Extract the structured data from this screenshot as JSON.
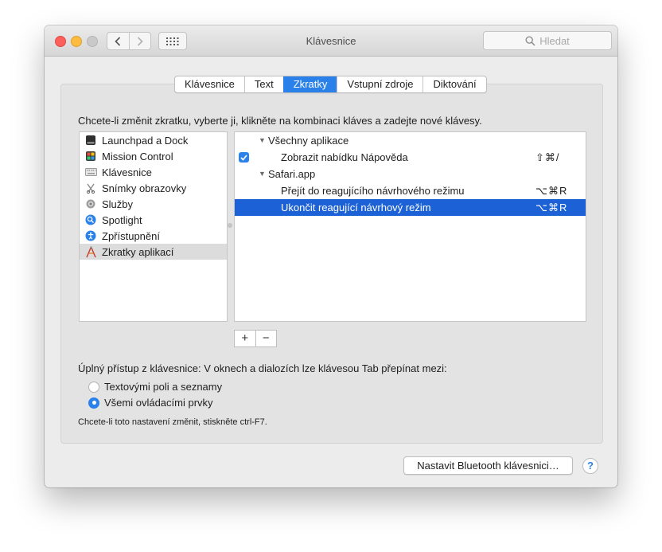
{
  "window": {
    "title": "Klávesnice"
  },
  "search": {
    "placeholder": "Hledat"
  },
  "icons": {
    "back": "chevron-left-icon",
    "forward": "chevron-right-icon",
    "grid": "grid-icon",
    "search": "search-icon"
  },
  "tabs": [
    {
      "label": "Klávesnice",
      "active": false
    },
    {
      "label": "Text",
      "active": false
    },
    {
      "label": "Zkratky",
      "active": true
    },
    {
      "label": "Vstupní zdroje",
      "active": false
    },
    {
      "label": "Diktování",
      "active": false
    }
  ],
  "instructions": "Chcete-li změnit zkratku, vyberte ji, klikněte na kombinaci kláves a zadejte nové klávesy.",
  "categories": [
    {
      "label": "Launchpad a Dock",
      "icon": "launchpad-icon"
    },
    {
      "label": "Mission Control",
      "icon": "mission-control-icon"
    },
    {
      "label": "Klávesnice",
      "icon": "keyboard-icon"
    },
    {
      "label": "Snímky obrazovky",
      "icon": "screenshot-icon"
    },
    {
      "label": "Služby",
      "icon": "gear-icon"
    },
    {
      "label": "Spotlight",
      "icon": "spotlight-icon"
    },
    {
      "label": "Zpřístupnění",
      "icon": "accessibility-icon"
    },
    {
      "label": "Zkratky aplikací",
      "icon": "app-shortcuts-icon",
      "selected": true
    }
  ],
  "shortcuts": [
    {
      "type": "group",
      "label": "Všechny aplikace"
    },
    {
      "type": "item",
      "label": "Zobrazit nabídku Nápověda",
      "keys": "⇧⌘/",
      "checked": true
    },
    {
      "type": "group",
      "label": "Safari.app"
    },
    {
      "type": "item",
      "label": "Přejít do reagujícího návrhového režimu",
      "keys": "⌥⌘R"
    },
    {
      "type": "item",
      "label": "Ukončit reagující návrhový režim",
      "keys": "⌥⌘R",
      "selected": true
    }
  ],
  "controls": {
    "add": "+",
    "remove": "−"
  },
  "keyboard_access": {
    "label": "Úplný přístup z klávesnice: V oknech a dialozích lze klávesou Tab přepínat mezi:",
    "options": [
      {
        "label": "Textovými poli a seznamy",
        "selected": false
      },
      {
        "label": "Všemi ovládacími prvky",
        "selected": true
      }
    ],
    "hint": "Chcete-li toto nastavení změnit, stiskněte ctrl-F7."
  },
  "bluetooth_button": "Nastavit Bluetooth klávesnici…",
  "help_button": "?",
  "colors": {
    "accent": "#2b81ea",
    "selection": "#1c62d6"
  }
}
